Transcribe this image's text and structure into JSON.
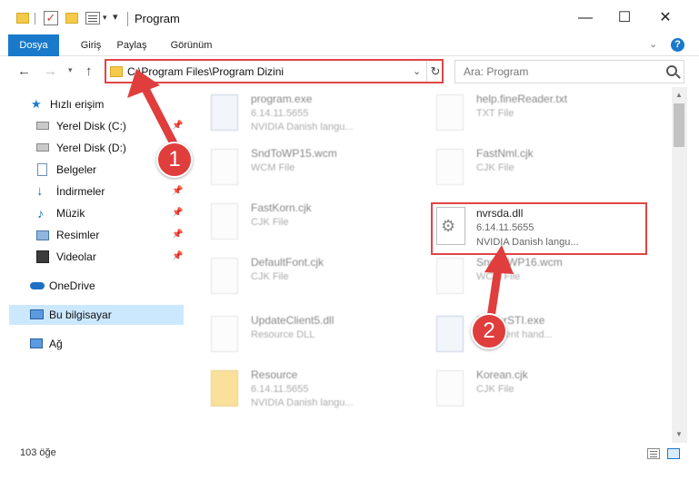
{
  "window": {
    "title": "Program",
    "controls": {
      "minimize": "—",
      "maximize": "☐",
      "close": "✕"
    }
  },
  "ribbon": {
    "tabs": [
      "Dosya",
      "Giriş",
      "Paylaş",
      "Görünüm"
    ],
    "help": "?"
  },
  "nav": {
    "address": "C:\\Program Files\\Program Dizini",
    "search_placeholder": "Ara: Program"
  },
  "sidebar": {
    "quick_access": "Hızlı erişim",
    "items": [
      {
        "label": "Yerel Disk (C:)",
        "icon": "drive-icon"
      },
      {
        "label": "Yerel Disk (D:)",
        "icon": "drive-icon"
      },
      {
        "label": "Belgeler",
        "icon": "documents-icon"
      },
      {
        "label": "İndirmeler",
        "icon": "download-icon"
      },
      {
        "label": "Müzik",
        "icon": "music-icon"
      },
      {
        "label": "Resimler",
        "icon": "pictures-icon"
      },
      {
        "label": "Videolar",
        "icon": "videos-icon"
      }
    ],
    "onedrive": "OneDrive",
    "this_pc": "Bu bilgisayar",
    "network": "Ağ"
  },
  "files": [
    {
      "name": "program.exe",
      "line2": "6.14.11.5655",
      "line3": "NVIDIA Danish langu...",
      "kind": "exe"
    },
    {
      "name": "help.fineReader.txt",
      "line2": "TXT File",
      "line3": "",
      "kind": "doc"
    },
    {
      "name": "SndToWP15.wcm",
      "line2": "WCM File",
      "line3": "",
      "kind": "doc"
    },
    {
      "name": "FastNml.cjk",
      "line2": "CJK File",
      "line3": "",
      "kind": "doc"
    },
    {
      "name": "FastKorn.cjk",
      "line2": "CJK File",
      "line3": "",
      "kind": "doc"
    },
    {
      "name": "DefaultFont.cjk",
      "line2": "CJK File",
      "line3": "",
      "kind": "doc"
    },
    {
      "name": "SndToWP16.wcm",
      "line2": "WCM File",
      "line3": "",
      "kind": "doc"
    },
    {
      "name": "UpdateClient5.dll",
      "line2": "Resource DLL",
      "line3": "",
      "kind": "doc"
    },
    {
      "name": "PlayerSTI.exe",
      "line2": "STI event hand...",
      "line3": "",
      "kind": "exe"
    },
    {
      "name": "Resource",
      "line2": "6.14.11.5655",
      "line3": "NVIDIA Danish langu...",
      "kind": "fold"
    },
    {
      "name": "Korean.cjk",
      "line2": "CJK File",
      "line3": "",
      "kind": "doc"
    }
  ],
  "highlighted_file": {
    "name": "nvrsda.dll",
    "version": "6.14.11.5655",
    "description": "NVIDIA Danish langu..."
  },
  "status": {
    "count": "103 öğe"
  },
  "callouts": [
    "1",
    "2"
  ],
  "colors": {
    "accent": "#1979ca",
    "highlight": "#e04545",
    "callout": "#e03d3d"
  }
}
